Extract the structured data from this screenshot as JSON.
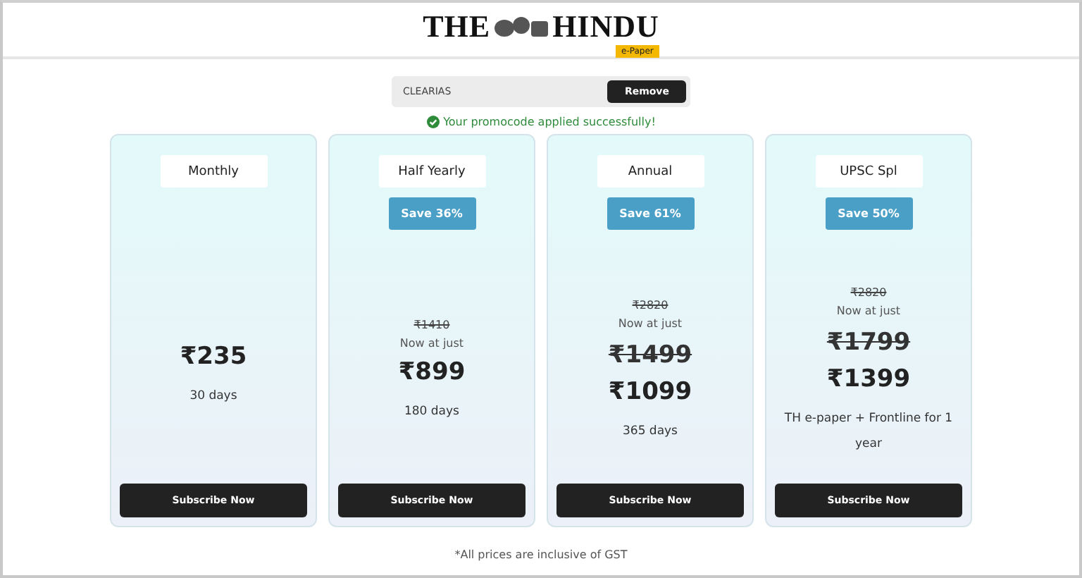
{
  "logo": {
    "left": "THE",
    "right": "HINDU",
    "badge": "e-Paper"
  },
  "promo": {
    "code": "CLEARIAS",
    "button": "Remove",
    "message": "Your promocode applied successfully!"
  },
  "plans": [
    {
      "name": "Monthly",
      "price": "₹235",
      "detail": "30 days",
      "button": "Subscribe Now"
    },
    {
      "name": "Half Yearly",
      "save": "Save 36%",
      "mrp": "₹1410",
      "now": "Now at just",
      "price": "₹899",
      "detail": "180 days",
      "button": "Subscribe Now"
    },
    {
      "name": "Annual",
      "save": "Save 61%",
      "mrp": "₹2820",
      "now": "Now at just",
      "old_price": "₹1499",
      "price": "₹1099",
      "detail": "365 days",
      "button": "Subscribe Now"
    },
    {
      "name": "UPSC Spl",
      "save": "Save 50%",
      "mrp": "₹2820",
      "now": "Now at just",
      "old_price": "₹1799",
      "price": "₹1399",
      "detail": "TH e-paper + Frontline for 1 year",
      "button": "Subscribe Now"
    }
  ],
  "footnote": "*All prices are inclusive of GST"
}
